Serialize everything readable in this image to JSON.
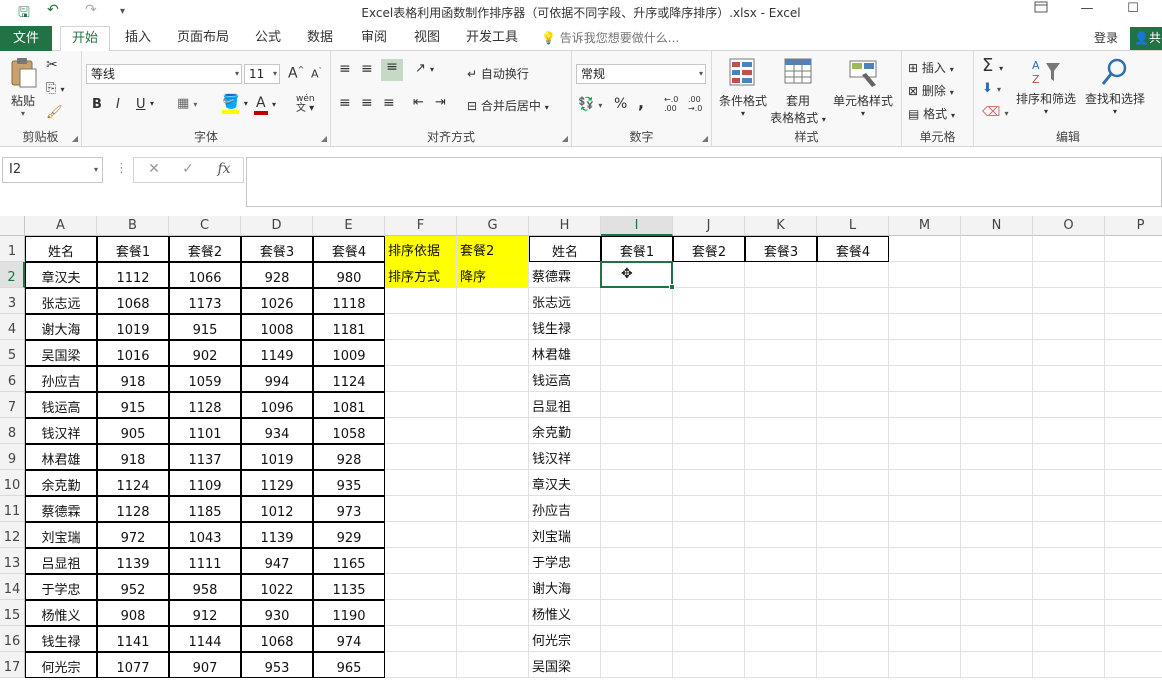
{
  "window": {
    "title": "Excel表格利用函数制作排序器（可依据不同字段、升序或降序排序）.xlsx - Excel",
    "restore_icon": "restore-icon",
    "minimize_symbol": "—",
    "maximize_symbol": "☐"
  },
  "quick_access": {
    "save_symbol": "🖫",
    "undo_symbol": "↶",
    "redo_symbol": "↷",
    "more_symbol": "▾"
  },
  "tabs": {
    "file": "文件",
    "items": [
      "开始",
      "插入",
      "页面布局",
      "公式",
      "数据",
      "审阅",
      "视图",
      "开发工具"
    ],
    "active": "开始",
    "tell_me": "告诉我您想要做什么...",
    "login": "登录",
    "share": "共"
  },
  "ribbon": {
    "clipboard": {
      "label": "剪贴板",
      "paste": "粘贴"
    },
    "font": {
      "label": "字体",
      "name": "等线",
      "size": "11",
      "grow": "A",
      "shrink": "A",
      "bold": "B",
      "italic": "I",
      "underline": "U",
      "wen": "wén"
    },
    "alignment": {
      "label": "对齐方式",
      "wrap": "自动换行",
      "merge": "合并后居中"
    },
    "number": {
      "label": "数字",
      "format": "常规",
      "percent": "%",
      "comma": ","
    },
    "styles": {
      "label": "样式",
      "conditional": "条件格式",
      "table_line1": "套用",
      "table_line2": "表格格式",
      "cell_styles": "单元格样式"
    },
    "cells": {
      "label": "单元格",
      "insert": "插入",
      "delete": "删除",
      "format": "格式"
    },
    "editing": {
      "label": "编辑",
      "sort_filter": "排序和筛选",
      "find_select": "查找和选择"
    }
  },
  "formula_bar": {
    "name_box": "I2",
    "fx": "fx",
    "cancel": "✕",
    "enter": "✓",
    "value": ""
  },
  "sheet": {
    "columns": [
      "A",
      "B",
      "C",
      "D",
      "E",
      "F",
      "G",
      "H",
      "I",
      "J",
      "K",
      "L",
      "M",
      "N",
      "O",
      "P"
    ],
    "rows": [
      "1",
      "2",
      "3",
      "4",
      "5",
      "6",
      "7",
      "8",
      "9",
      "10",
      "11",
      "12",
      "13",
      "14",
      "15",
      "16",
      "17"
    ],
    "selected_column": "I",
    "selected_row": "2",
    "table_header": [
      "姓名",
      "套餐1",
      "套餐2",
      "套餐3",
      "套餐4"
    ],
    "table_rows": [
      [
        "章汉夫",
        "1112",
        "1066",
        "928",
        "980"
      ],
      [
        "张志远",
        "1068",
        "1173",
        "1026",
        "1118"
      ],
      [
        "谢大海",
        "1019",
        "915",
        "1008",
        "1181"
      ],
      [
        "吴国梁",
        "1016",
        "902",
        "1149",
        "1009"
      ],
      [
        "孙应吉",
        "918",
        "1059",
        "994",
        "1124"
      ],
      [
        "钱运高",
        "915",
        "1128",
        "1096",
        "1081"
      ],
      [
        "钱汉祥",
        "905",
        "1101",
        "934",
        "1058"
      ],
      [
        "林君雄",
        "918",
        "1137",
        "1019",
        "928"
      ],
      [
        "余克勤",
        "1124",
        "1109",
        "1129",
        "935"
      ],
      [
        "蔡德霖",
        "1128",
        "1185",
        "1012",
        "973"
      ],
      [
        "刘宝瑞",
        "972",
        "1043",
        "1139",
        "929"
      ],
      [
        "吕显祖",
        "1139",
        "1111",
        "947",
        "1165"
      ],
      [
        "于学忠",
        "952",
        "958",
        "1022",
        "1135"
      ],
      [
        "杨惟义",
        "908",
        "912",
        "930",
        "1190"
      ],
      [
        "钱生禄",
        "1141",
        "1144",
        "1068",
        "974"
      ],
      [
        "何光宗",
        "1077",
        "907",
        "953",
        "965"
      ]
    ],
    "criteria": {
      "sort_by_label": "排序依据",
      "sort_by_value": "套餐2",
      "sort_order_label": "排序方式",
      "sort_order_value": "降序"
    },
    "result_header": [
      "姓名",
      "套餐1",
      "套餐2",
      "套餐3",
      "套餐4"
    ],
    "result_names": [
      "蔡德霖",
      "张志远",
      "钱生禄",
      "林君雄",
      "钱运高",
      "吕显祖",
      "余克勤",
      "钱汉祥",
      "章汉夫",
      "孙应吉",
      "刘宝瑞",
      "于学忠",
      "谢大海",
      "杨惟义",
      "何光宗",
      "吴国梁"
    ],
    "highlight_color": "#ffff00",
    "accent_color": "#217346"
  }
}
